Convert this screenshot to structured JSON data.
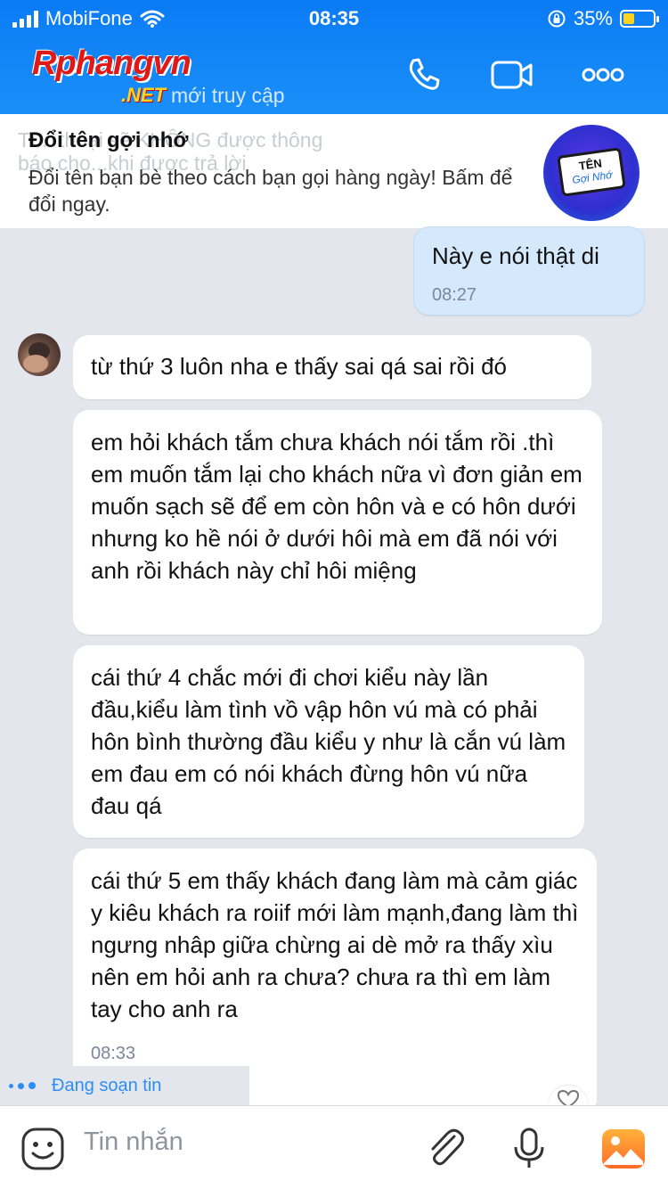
{
  "status": {
    "carrier": "MobiFone",
    "time": "08:35",
    "battery": "35%"
  },
  "header": {
    "logo_main": "Rphangvn",
    "logo_sub": ".NET",
    "subtitle": "mới truy cập"
  },
  "banner": {
    "ghost_text": "Tí... thoại sẽ KHÔNG được thông\nbáo cho...khi được trả lời",
    "title": "Đổi tên gợi nhớ",
    "text": "Đổi tên bạn bè theo cách bạn gọi hàng ngày! Bấm để đổi ngay.",
    "badge_line1": "TÊN",
    "badge_line2": "Gợi Nhớ"
  },
  "messages": [
    {
      "from": "me",
      "text": "Này e nói thật di",
      "time": "08:27"
    },
    {
      "from": "other",
      "text": "từ thứ 3 luôn nha e thấy sai qá sai rồi đó"
    },
    {
      "from": "other",
      "text": "em hỏi khách tắm chưa khách nói tắm rồi .thì em muốn tắm lại cho khách nữa vì đơn giản em muốn sạch sẽ để em còn hôn và e có hôn dưới nhưng ko hề nói ở dưới hôi mà em đã nói với anh rồi khách này chỉ hôi miệng"
    },
    {
      "from": "other",
      "text": "cái thứ 4 chắc mới đi chơi kiểu này lần đầu,kiểu làm tình vồ vập hôn vú mà có phải hôn bình thường đầu kiểu y như là cắn vú làm em đau em có nói khách đừng hôn vú nữa đau qá"
    },
    {
      "from": "other",
      "text": "cái thứ 5 em thấy khách đang làm mà cảm giác y kiêu khách ra roiif mới làm mạnh,đang làm thì ngưng nhâp giữa chừng ai dè mở ra thấy xìu nên em hỏi anh ra chưa? chưa ra thì em làm tay cho anh ra",
      "time": "08:33"
    }
  ],
  "typing": "Đang soạn tin",
  "input": {
    "placeholder": "Tin nhắn"
  },
  "icons": [
    "phone-icon",
    "video-call-icon",
    "more-icon",
    "sticker-icon",
    "attach-icon",
    "mic-icon",
    "photo-icon",
    "close-icon"
  ],
  "colors": {
    "header": "#0b7bf5",
    "mine_bubble": "#d5e9fd",
    "chat_bg": "#e3e6ec",
    "accent": "#2c8df5"
  }
}
